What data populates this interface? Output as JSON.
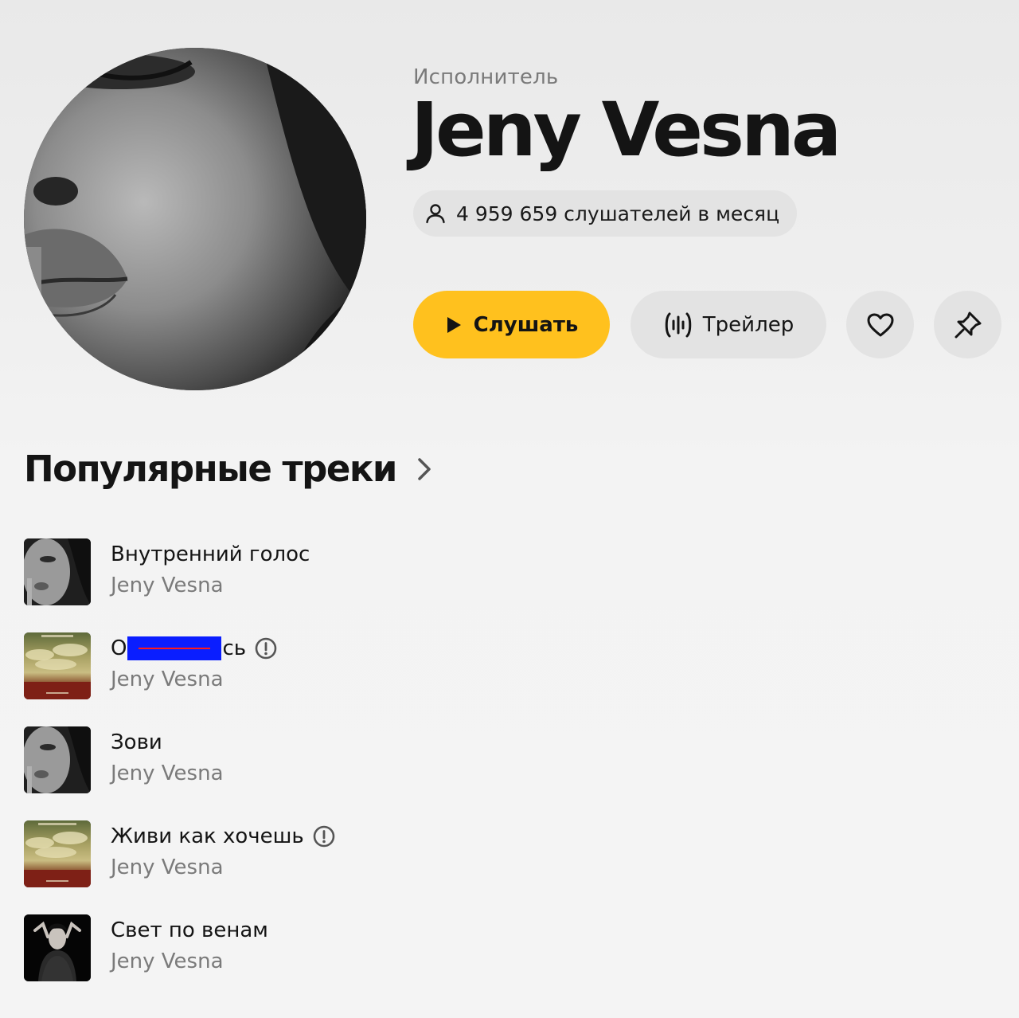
{
  "header": {
    "kind_label": "Исполнитель",
    "artist_name": "Jeny Vesna",
    "listeners": "4 959 659 слушателей в месяц",
    "icons": {
      "listeners": "user-icon"
    }
  },
  "actions": {
    "listen_label": "Слушать",
    "trailer_label": "Трейлер",
    "icons": {
      "listen": "play-icon",
      "trailer": "soundwave-icon",
      "like": "heart-icon",
      "pin": "pin-icon"
    },
    "colors": {
      "primary": "#ffc11e",
      "secondary": "#e3e3e3"
    }
  },
  "popular": {
    "title": "Популярные треки",
    "tracks": [
      {
        "title": "Внутренний голос",
        "artist": "Jeny Vesna",
        "explicit": false,
        "cover": "portrait"
      },
      {
        "title_start": "О",
        "title_end": "сь",
        "redacted": true,
        "artist": "Jeny Vesna",
        "explicit": true,
        "cover": "landscape"
      },
      {
        "title": "Зови",
        "artist": "Jeny Vesna",
        "explicit": false,
        "cover": "portrait"
      },
      {
        "title": "Живи как хочешь",
        "artist": "Jeny Vesna",
        "explicit": true,
        "cover": "landscape"
      },
      {
        "title": "Свет по венам",
        "artist": "Jeny Vesna",
        "explicit": false,
        "cover": "dark-portrait"
      }
    ]
  }
}
